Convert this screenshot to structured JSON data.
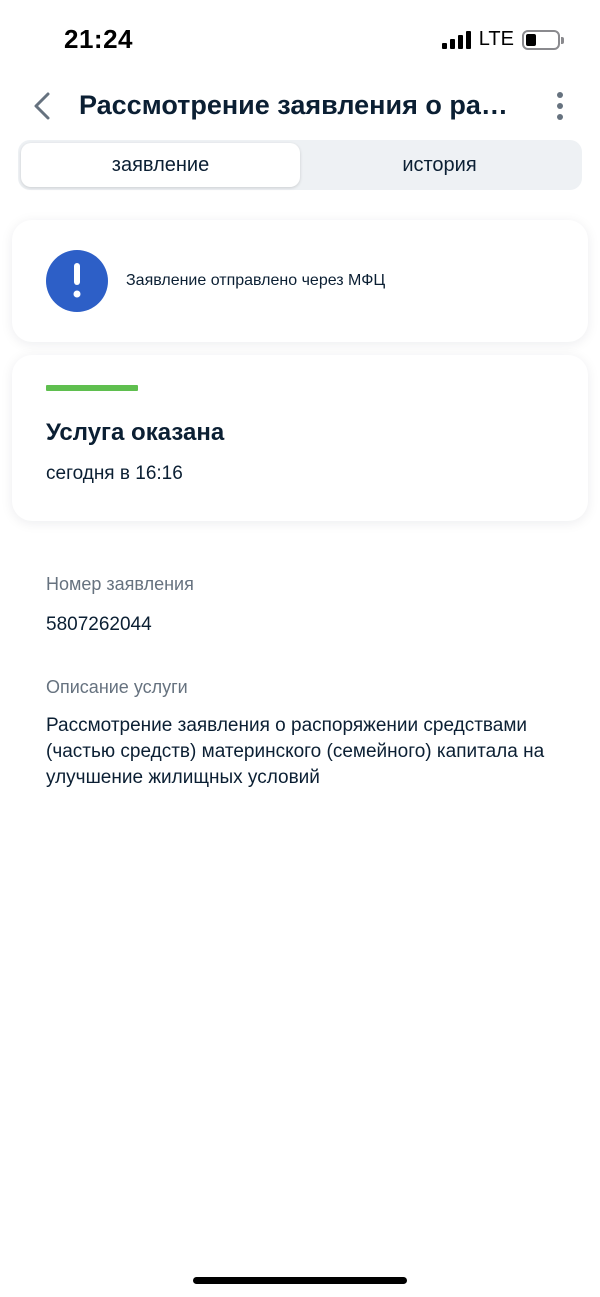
{
  "status_bar": {
    "time": "21:24",
    "network": "LTE",
    "icons": [
      "signal-icon",
      "battery-icon"
    ]
  },
  "header": {
    "back_icon": "chevron-left-icon",
    "title": "Рассмотрение заявления о распоряжении средствами",
    "menu_icon": "more-vertical-icon"
  },
  "tabs": [
    {
      "label": "заявление",
      "active": true
    },
    {
      "label": "история",
      "active": false
    }
  ],
  "info_card": {
    "icon": "exclamation-icon",
    "text": "Заявление отправлено через МФЦ",
    "icon_color": "#2d5fc7"
  },
  "status_card": {
    "title": "Услуга оказана",
    "time": "сегодня в 16:16",
    "accent_color": "#5fbf4f"
  },
  "details": {
    "number_label": "Номер заявления",
    "number_value": "5807262044",
    "description_label": "Описание услуги",
    "description_value": "Рассмотрение заявления о распоряжении средствами (частью средств) материнского (семейного) капитала на улучшение жилищных условий"
  }
}
